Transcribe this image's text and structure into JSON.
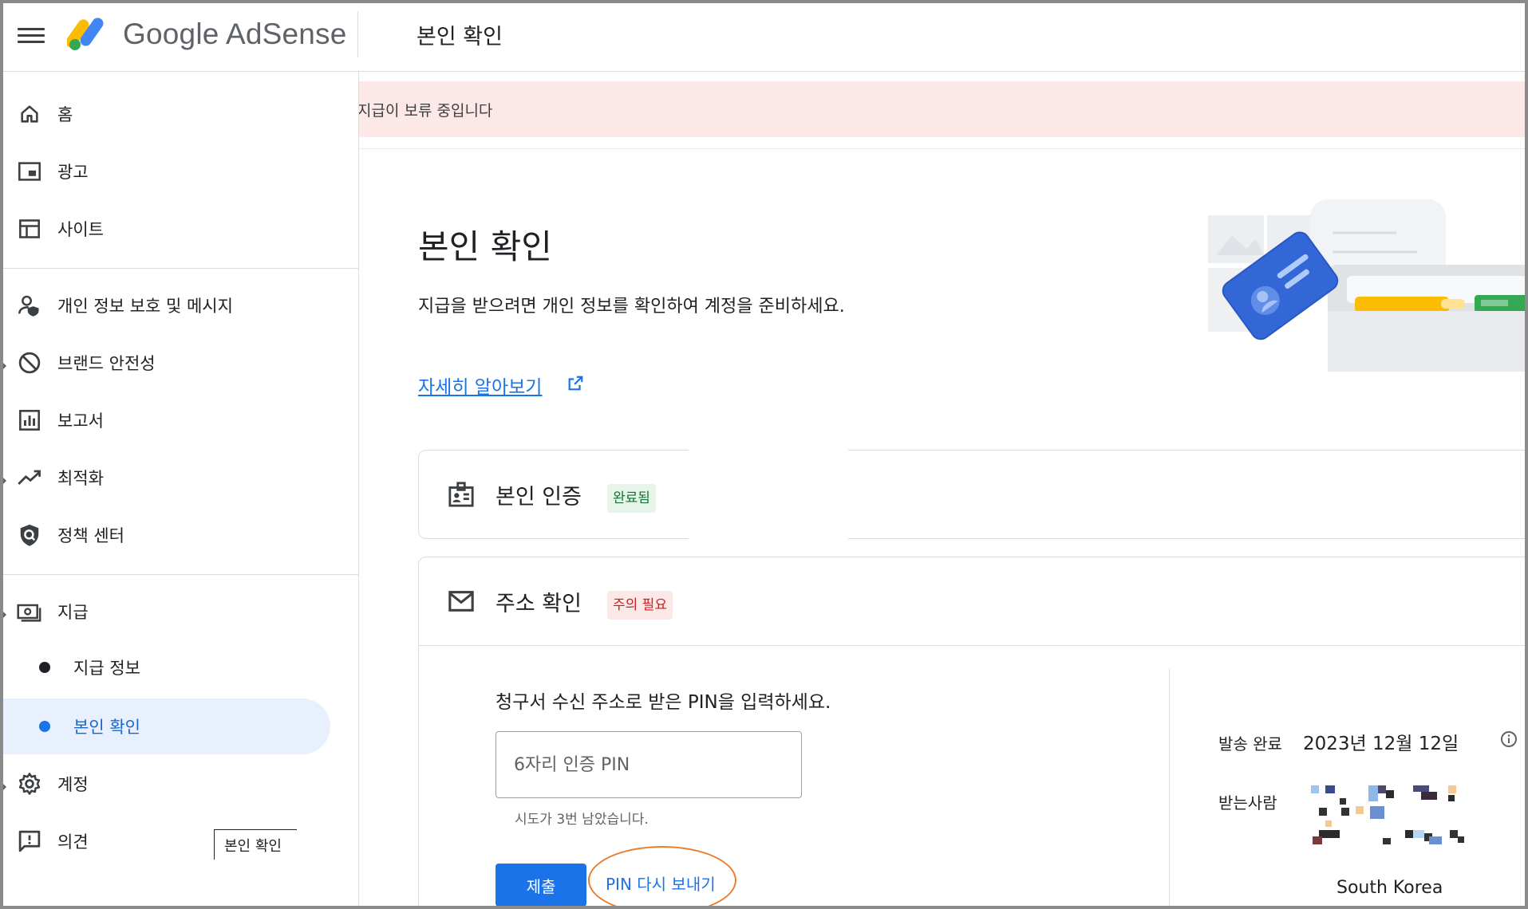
{
  "header": {
    "brand": "Google AdSense",
    "page_heading": "본인 확인"
  },
  "sidebar": {
    "items": [
      {
        "label": "홈",
        "icon": "home-icon"
      },
      {
        "label": "광고",
        "icon": "ads-icon"
      },
      {
        "label": "사이트",
        "icon": "sites-icon"
      },
      {
        "label": "개인 정보 보호 및 메시지",
        "icon": "privacy-icon"
      },
      {
        "label": "브랜드 안전성",
        "icon": "block-icon"
      },
      {
        "label": "보고서",
        "icon": "reports-icon"
      },
      {
        "label": "최적화",
        "icon": "trending-icon"
      },
      {
        "label": "정책 센터",
        "icon": "policy-icon"
      },
      {
        "label": "지급",
        "icon": "payments-icon"
      },
      {
        "label": "계정",
        "icon": "gear-icon"
      },
      {
        "label": "의견",
        "icon": "feedback-icon"
      }
    ],
    "sub_items": [
      {
        "label": "지급 정보"
      },
      {
        "label": "본인 확인"
      }
    ],
    "tooltip": "본인 확인"
  },
  "banner": {
    "text": "지급이 보류 중입니다"
  },
  "main": {
    "title": "본인 확인",
    "description": "지급을 받으려면 개인 정보를 확인하여 계정을 준비하세요.",
    "learn_more": "자세히 알아보기"
  },
  "identity_card": {
    "title": "본인 인증",
    "status": "완료됨"
  },
  "address_card": {
    "title": "주소 확인",
    "status": "주의 필요",
    "prompt": "청구서 수신 주소로 받은 PIN을 입력하세요.",
    "pin_placeholder": "6자리 인증 PIN",
    "attempts": "시도가 3번 남았습니다.",
    "submit": "제출",
    "resend": "PIN 다시 보내기",
    "sent_label": "발송 완료",
    "sent_date": "2023년 12월 12일",
    "recipient_label": "받는사람",
    "country": "South Korea"
  },
  "colors": {
    "accent": "#1a73e8",
    "banner_bg": "#fce8e6",
    "success_chip": "#e6f4ea",
    "warn_chip": "#fce8e6",
    "highlight_ring": "#ea7d2c"
  }
}
